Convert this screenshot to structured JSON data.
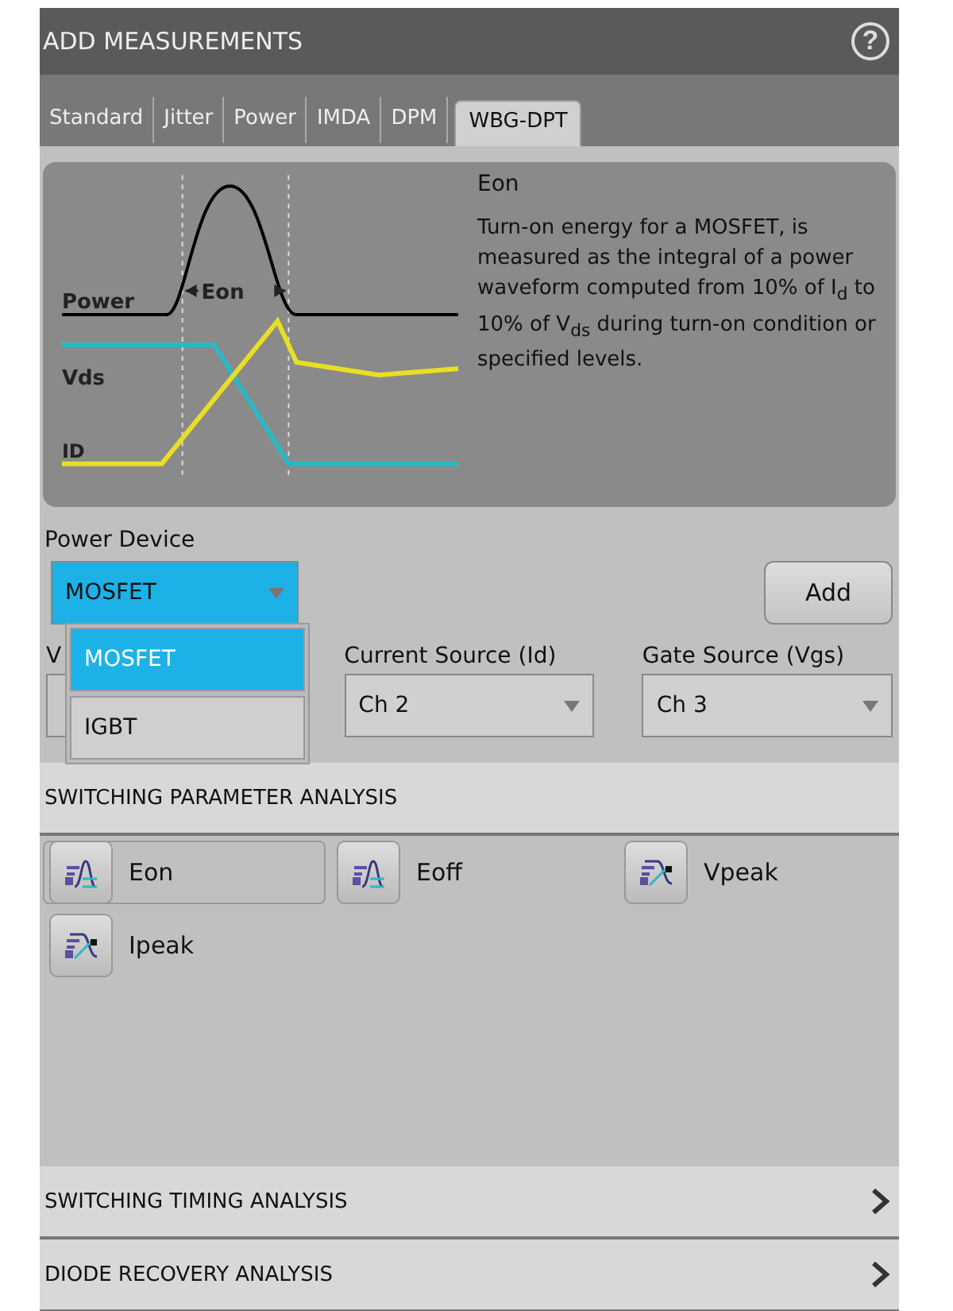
{
  "window": {
    "title": "ADD MEASUREMENTS",
    "help": "?"
  },
  "tabs": [
    {
      "label": "Standard",
      "selected": false
    },
    {
      "label": "Jitter",
      "selected": false
    },
    {
      "label": "Power",
      "selected": false
    },
    {
      "label": "IMDA",
      "selected": false
    },
    {
      "label": "DPM",
      "selected": false
    },
    {
      "label": "WBG-DPT",
      "selected": true
    }
  ],
  "diagram": {
    "labels": [
      "Power",
      "Vds",
      "ID"
    ],
    "span": "Eon"
  },
  "info": {
    "title": "Eon",
    "text": "Turn-on energy for a MOSFET, is measured as the integral of a power waveform computed from 10% of I$_{d}$ to 10% of V$_{ds}$ during turn-on condition or specified levels."
  },
  "power_device": {
    "label": "Power Device",
    "value": "MOSFET",
    "expanded": true,
    "options": [
      {
        "label": "MOSFET",
        "selected": true
      },
      {
        "label": "IGBT",
        "selected": false
      }
    ]
  },
  "add_button": "Add",
  "sources": [
    {
      "label": "V"
    },
    {
      "label": "Current Source (Id)",
      "value": "Ch 2"
    },
    {
      "label": "Gate Source (Vgs)",
      "value": "Ch 3"
    }
  ],
  "sections": [
    {
      "title": "SWITCHING PARAMETER ANALYSIS",
      "expanded": true,
      "items": [
        {
          "label": "Eon",
          "selected": true,
          "kind": "energy"
        },
        {
          "label": "Eoff",
          "selected": false,
          "kind": "energy"
        },
        {
          "label": "Vpeak",
          "selected": false,
          "kind": "peak"
        },
        {
          "label": "Ipeak",
          "selected": false,
          "kind": "peak"
        }
      ]
    },
    {
      "title": "SWITCHING TIMING ANALYSIS",
      "expanded": false
    },
    {
      "title": "DIODE RECOVERY ANALYSIS",
      "expanded": false
    }
  ]
}
